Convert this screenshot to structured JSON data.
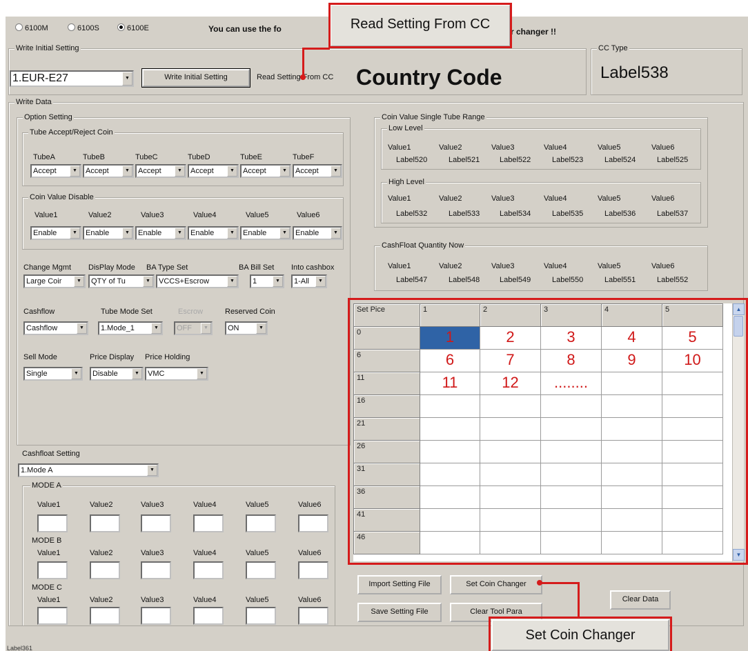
{
  "top": {
    "radios": [
      {
        "label": "6100M",
        "selected": false
      },
      {
        "label": "6100S",
        "selected": false
      },
      {
        "label": "6100E",
        "selected": true
      }
    ],
    "message_left": "You can use the fo",
    "message_right": "r changer !!"
  },
  "write_initial": {
    "title": "Write Initial Setting",
    "country_select": "1.EUR-E27",
    "write_button": "Write Initial Setting",
    "read_button": "Read Setting From CC",
    "country_code": "Country Code"
  },
  "cc_type": {
    "title": "CC Type",
    "value": "Label538"
  },
  "write_data": {
    "title": "Write Data"
  },
  "option_setting": {
    "title": "Option Setting"
  },
  "tube_accept": {
    "title": "Tube Accept/Reject Coin",
    "tubes": [
      "TubeA",
      "TubeB",
      "TubeC",
      "TubeD",
      "TubeE",
      "TubeF"
    ],
    "values": [
      "Accept",
      "Accept",
      "Accept",
      "Accept",
      "Accept",
      "Accept"
    ]
  },
  "coin_disable": {
    "title": "Coin Value Disable",
    "labels": [
      "Value1",
      "Value2",
      "Value3",
      "Value4",
      "Value5",
      "Value6"
    ],
    "values": [
      "Enable",
      "Enable",
      "Enable",
      "Enable",
      "Enable",
      "Enable"
    ]
  },
  "modes": {
    "change_mgmt": {
      "label": "Change Mgmt",
      "value": "Large Coir"
    },
    "display_mode": {
      "label": "DisPlay Mode",
      "value": "QTY of Tu"
    },
    "ba_type": {
      "label": "BA Type Set",
      "value": "VCCS+Escrow"
    },
    "ba_bill": {
      "label": "BA Bill Set",
      "value": "1"
    },
    "into_cashbox": {
      "label": "Into cashbox",
      "value": "1-All"
    },
    "cashflow": {
      "label": "Cashflow",
      "value": "Cashflow"
    },
    "tube_mode": {
      "label": "Tube Mode Set",
      "value": "1.Mode_1"
    },
    "escrow": {
      "label": "Escrow",
      "value": "OFF"
    },
    "reserved": {
      "label": "Reserved Coin",
      "value": "ON"
    },
    "sell_mode": {
      "label": "Sell Mode",
      "value": "Single"
    },
    "price_display": {
      "label": "Price Display",
      "value": "Disable"
    },
    "price_holding": {
      "label": "Price Holding",
      "value": "VMC"
    }
  },
  "cashfloat_setting": {
    "title": "Cashfloat Setting",
    "mode_select": "1.Mode A",
    "modes": [
      "MODE A",
      "MODE B",
      "MODE C"
    ],
    "value_labels": [
      "Value1",
      "Value2",
      "Value3",
      "Value4",
      "Value5",
      "Value6"
    ]
  },
  "coin_range": {
    "title": "Coin Value Single Tube Range",
    "low_title": "Low Level",
    "high_title": "High Level",
    "value_labels": [
      "Value1",
      "Value2",
      "Value3",
      "Value4",
      "Value5",
      "Value6"
    ],
    "low_values": [
      "Label520",
      "Label521",
      "Label522",
      "Label523",
      "Label524",
      "Label525"
    ],
    "high_values": [
      "Label532",
      "Label533",
      "Label534",
      "Label535",
      "Label536",
      "Label537"
    ]
  },
  "cashfloat_now": {
    "title": "CashFloat Quantity Now",
    "value_labels": [
      "Value1",
      "Value2",
      "Value3",
      "Value4",
      "Value5",
      "Value6"
    ],
    "values": [
      "Label547",
      "Label548",
      "Label549",
      "Label550",
      "Label551",
      "Label552"
    ]
  },
  "price_grid": {
    "corner": "Set Pice",
    "columns": [
      "1",
      "2",
      "3",
      "4",
      "5"
    ],
    "row_headers": [
      "0",
      "6",
      "11",
      "16",
      "21",
      "26",
      "31",
      "36",
      "41",
      "46"
    ],
    "rows": [
      [
        "1",
        "2",
        "3",
        "4",
        "5"
      ],
      [
        "6",
        "7",
        "8",
        "9",
        "10"
      ],
      [
        "11",
        "12",
        "........",
        "",
        ""
      ],
      [
        "",
        "",
        "",
        "",
        ""
      ],
      [
        "",
        "",
        "",
        "",
        ""
      ],
      [
        "",
        "",
        "",
        "",
        ""
      ],
      [
        "",
        "",
        "",
        "",
        ""
      ],
      [
        "",
        "",
        "",
        "",
        ""
      ],
      [
        "",
        "",
        "",
        "",
        ""
      ],
      [
        "",
        "",
        "",
        "",
        ""
      ]
    ]
  },
  "bottom_buttons": {
    "import": "Import Setting File",
    "set_coin": "Set  Coin Changer",
    "save": "Save Setting File",
    "clear_tool": "Clear Tool Para",
    "clear_data": "Clear Data"
  },
  "callouts": {
    "read": "Read Setting From CC",
    "set": "Set  Coin Changer"
  },
  "status": {
    "text": "Label361"
  },
  "colors": {
    "accent": "#d51b1b",
    "selection": "#2f63a6",
    "window": "#d4d0c8"
  }
}
